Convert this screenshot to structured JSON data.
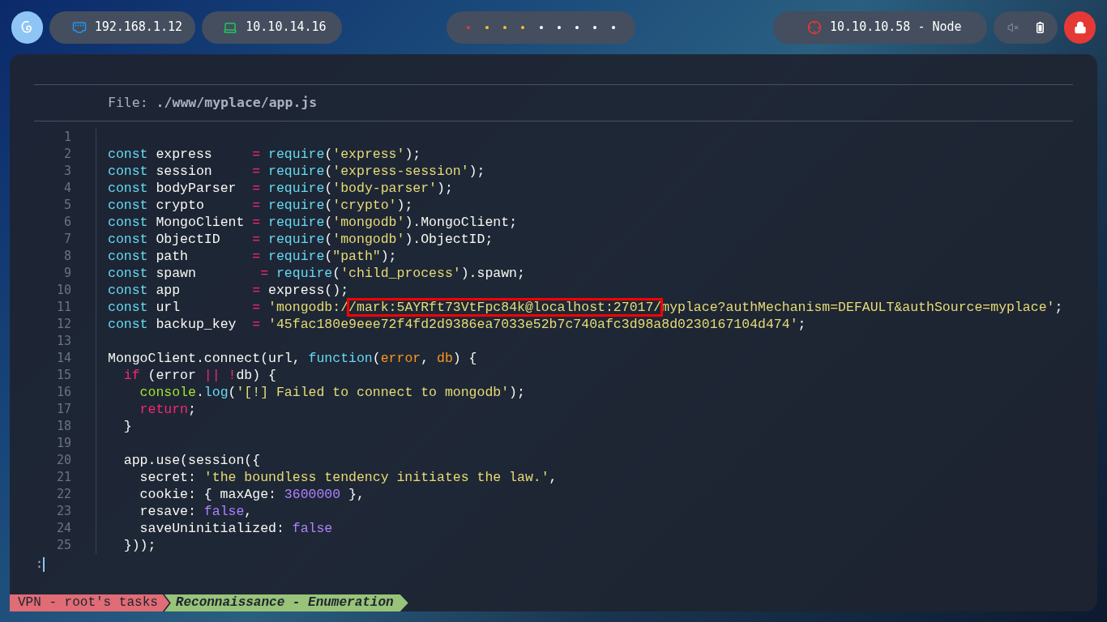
{
  "topbar": {
    "ip_local": "192.168.1.12",
    "ip_vpn": "10.10.14.16",
    "workspaces": [
      {
        "color": "#e53935"
      },
      {
        "color": "#fbc02d"
      },
      {
        "color": "#fbc02d"
      },
      {
        "color": "#fbc02d"
      },
      {
        "color": "#ffffff"
      },
      {
        "color": "#ffffff"
      },
      {
        "color": "#ffffff"
      },
      {
        "color": "#ffffff"
      },
      {
        "color": "#ffffff"
      }
    ],
    "target": "10.10.10.58 - Node"
  },
  "viewer": {
    "file_label": "File: ",
    "file_path": "./www/myplace/app.js",
    "lines": [
      {
        "number": "1"
      },
      {
        "number": "2",
        "tokens": [
          {
            "text": "const",
            "kind": "keyword"
          },
          {
            "text": " express     ",
            "kind": "plain"
          },
          {
            "text": "= ",
            "kind": "operator"
          },
          {
            "text": "require",
            "kind": "keyword"
          },
          {
            "text": "(",
            "kind": "plain"
          },
          {
            "text": "'express'",
            "kind": "string"
          },
          {
            "text": ");",
            "kind": "plain"
          }
        ]
      },
      {
        "number": "3",
        "tokens": [
          {
            "text": "const",
            "kind": "keyword"
          },
          {
            "text": " session     ",
            "kind": "plain"
          },
          {
            "text": "= ",
            "kind": "operator"
          },
          {
            "text": "require",
            "kind": "keyword"
          },
          {
            "text": "(",
            "kind": "plain"
          },
          {
            "text": "'express-session'",
            "kind": "string"
          },
          {
            "text": ");",
            "kind": "plain"
          }
        ]
      },
      {
        "number": "4",
        "tokens": [
          {
            "text": "const",
            "kind": "keyword"
          },
          {
            "text": " bodyParser  ",
            "kind": "plain"
          },
          {
            "text": "= ",
            "kind": "operator"
          },
          {
            "text": "require",
            "kind": "keyword"
          },
          {
            "text": "(",
            "kind": "plain"
          },
          {
            "text": "'body-parser'",
            "kind": "string"
          },
          {
            "text": ");",
            "kind": "plain"
          }
        ]
      },
      {
        "number": "5",
        "tokens": [
          {
            "text": "const",
            "kind": "keyword"
          },
          {
            "text": " crypto      ",
            "kind": "plain"
          },
          {
            "text": "= ",
            "kind": "operator"
          },
          {
            "text": "require",
            "kind": "keyword"
          },
          {
            "text": "(",
            "kind": "plain"
          },
          {
            "text": "'crypto'",
            "kind": "string"
          },
          {
            "text": ");",
            "kind": "plain"
          }
        ]
      },
      {
        "number": "6",
        "tokens": [
          {
            "text": "const",
            "kind": "keyword"
          },
          {
            "text": " MongoClient ",
            "kind": "plain"
          },
          {
            "text": "= ",
            "kind": "operator"
          },
          {
            "text": "require",
            "kind": "keyword"
          },
          {
            "text": "(",
            "kind": "plain"
          },
          {
            "text": "'mongodb'",
            "kind": "string"
          },
          {
            "text": ").MongoClient;",
            "kind": "plain"
          }
        ]
      },
      {
        "number": "7",
        "tokens": [
          {
            "text": "const",
            "kind": "keyword"
          },
          {
            "text": " ObjectID    ",
            "kind": "plain"
          },
          {
            "text": "= ",
            "kind": "operator"
          },
          {
            "text": "require",
            "kind": "keyword"
          },
          {
            "text": "(",
            "kind": "plain"
          },
          {
            "text": "'mongodb'",
            "kind": "string"
          },
          {
            "text": ").ObjectID;",
            "kind": "plain"
          }
        ]
      },
      {
        "number": "8",
        "tokens": [
          {
            "text": "const",
            "kind": "keyword"
          },
          {
            "text": " path        ",
            "kind": "plain"
          },
          {
            "text": "= ",
            "kind": "operator"
          },
          {
            "text": "require",
            "kind": "keyword"
          },
          {
            "text": "(",
            "kind": "plain"
          },
          {
            "text": "\"path\"",
            "kind": "string"
          },
          {
            "text": ");",
            "kind": "plain"
          }
        ]
      },
      {
        "number": "9",
        "tokens": [
          {
            "text": "const",
            "kind": "keyword"
          },
          {
            "text": " spawn        ",
            "kind": "plain"
          },
          {
            "text": "= ",
            "kind": "operator"
          },
          {
            "text": "require",
            "kind": "keyword"
          },
          {
            "text": "(",
            "kind": "plain"
          },
          {
            "text": "'child_process'",
            "kind": "string"
          },
          {
            "text": ").spawn;",
            "kind": "plain"
          }
        ]
      },
      {
        "number": "10",
        "tokens": [
          {
            "text": "const",
            "kind": "keyword"
          },
          {
            "text": " app         ",
            "kind": "plain"
          },
          {
            "text": "=",
            "kind": "operator"
          },
          {
            "text": " express();",
            "kind": "plain"
          }
        ]
      },
      {
        "number": "11",
        "tokens": [
          {
            "text": "const",
            "kind": "keyword"
          },
          {
            "text": " url         ",
            "kind": "plain"
          },
          {
            "text": "= ",
            "kind": "operator"
          },
          {
            "text": "'mongodb:/",
            "kind": "string"
          },
          {
            "text": "/mark:5AYRft73VtFpc84k@localhost:27017/",
            "kind": "boxed"
          },
          {
            "text": "myplace?authMechanism=DEFAULT&authSource=myplace'",
            "kind": "string"
          },
          {
            "text": ";",
            "kind": "plain"
          }
        ]
      },
      {
        "number": "12",
        "tokens": [
          {
            "text": "const",
            "kind": "keyword"
          },
          {
            "text": " backup_key  ",
            "kind": "plain"
          },
          {
            "text": "= ",
            "kind": "operator"
          },
          {
            "text": "'45fac180e9eee72f4fd2d9386ea7033e52b7c740afc3d98a8d0230167104d474'",
            "kind": "string"
          },
          {
            "text": ";",
            "kind": "plain"
          }
        ]
      },
      {
        "number": "13"
      },
      {
        "number": "14",
        "tokens": [
          {
            "text": "MongoClient.connect(url, ",
            "kind": "plain"
          },
          {
            "text": "function",
            "kind": "keyword"
          },
          {
            "text": "(",
            "kind": "plain"
          },
          {
            "text": "error",
            "kind": "param"
          },
          {
            "text": ", ",
            "kind": "plain"
          },
          {
            "text": "db",
            "kind": "param"
          },
          {
            "text": ") {",
            "kind": "plain"
          }
        ]
      },
      {
        "number": "15",
        "tokens": [
          {
            "text": "  if",
            "kind": "operator"
          },
          {
            "text": " (error ",
            "kind": "plain"
          },
          {
            "text": "|| !",
            "kind": "operator"
          },
          {
            "text": "db) {",
            "kind": "plain"
          }
        ]
      },
      {
        "number": "16",
        "tokens": [
          {
            "text": "    console",
            "kind": "object"
          },
          {
            "text": ".",
            "kind": "plain"
          },
          {
            "text": "log",
            "kind": "keyword"
          },
          {
            "text": "(",
            "kind": "plain"
          },
          {
            "text": "'[!] Failed to connect to mongodb'",
            "kind": "string"
          },
          {
            "text": ");",
            "kind": "plain"
          }
        ]
      },
      {
        "number": "17",
        "tokens": [
          {
            "text": "    return",
            "kind": "operator"
          },
          {
            "text": ";",
            "kind": "plain"
          }
        ]
      },
      {
        "number": "18",
        "tokens": [
          {
            "text": "  }",
            "kind": "plain"
          }
        ]
      },
      {
        "number": "19"
      },
      {
        "number": "20",
        "tokens": [
          {
            "text": "  app.use(session({",
            "kind": "plain"
          }
        ]
      },
      {
        "number": "21",
        "tokens": [
          {
            "text": "    secret: ",
            "kind": "plain"
          },
          {
            "text": "'the boundless tendency initiates the law.'",
            "kind": "string"
          },
          {
            "text": ",",
            "kind": "plain"
          }
        ]
      },
      {
        "number": "22",
        "tokens": [
          {
            "text": "    cookie: { maxAge: ",
            "kind": "plain"
          },
          {
            "text": "3600000",
            "kind": "number"
          },
          {
            "text": " },",
            "kind": "plain"
          }
        ]
      },
      {
        "number": "23",
        "tokens": [
          {
            "text": "    resave: ",
            "kind": "plain"
          },
          {
            "text": "false",
            "kind": "number"
          },
          {
            "text": ",",
            "kind": "plain"
          }
        ]
      },
      {
        "number": "24",
        "tokens": [
          {
            "text": "    saveUninitialized: ",
            "kind": "plain"
          },
          {
            "text": "false",
            "kind": "number"
          }
        ]
      },
      {
        "number": "25",
        "tokens": [
          {
            "text": "  }));",
            "kind": "plain"
          }
        ]
      }
    ],
    "prompt": ":"
  },
  "statusbar": {
    "session": "VPN - root's tasks",
    "window": "Reconnaissance - Enumeration"
  }
}
